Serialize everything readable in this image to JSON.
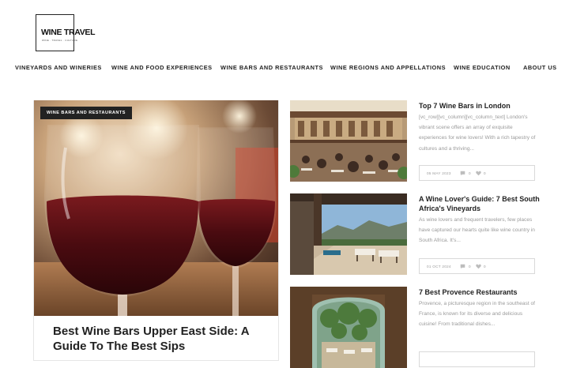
{
  "logo": {
    "title": "WINE TRAVEL",
    "tagline": "WINE · TRAVEL · CULTURE"
  },
  "nav": [
    {
      "label": "VINEYARDS AND WINERIES"
    },
    {
      "label": "WINE AND FOOD EXPERIENCES"
    },
    {
      "label": "WINE BARS AND RESTAURANTS"
    },
    {
      "label": "WINE REGIONS AND APPELLATIONS"
    },
    {
      "label": "WINE EDUCATION"
    },
    {
      "label": "ABOUT US"
    }
  ],
  "featured": {
    "category": "WINE BARS AND RESTAURANTS",
    "title": "Best Wine Bars Upper East Side: A Guide To The Best Sips",
    "image": "red-wine-glasses-photo"
  },
  "posts": [
    {
      "title": "Top 7 Wine Bars in London",
      "excerpt": "[vc_row][vc_column][vc_column_text] London's vibrant scene offers an array of exquisite experiences for wine lovers! With a rich tapestry of cultures and a thriving...",
      "date": "05 MAY 2023",
      "comments": "0",
      "likes": "0",
      "image": "courtyard-bar-photo"
    },
    {
      "title": "A Wine Lover's Guide: 7 Best South Africa's Vineyards",
      "excerpt": "As wine lovers and frequent travelers, few places have captured our hearts quite like wine country in South Africa. It's...",
      "date": "01 OCT 2024",
      "comments": "0",
      "likes": "0",
      "image": "vineyard-terrace-photo"
    },
    {
      "title": "7 Best Provence Restaurants",
      "excerpt": "Provence, a picturesque region in the southeast of France, is known for its diverse and delicious cuisine! From traditional dishes...",
      "date": "",
      "comments": "",
      "likes": "",
      "image": "provence-doorway-photo"
    }
  ],
  "icons": {
    "comments": "comment-icon",
    "likes": "heart-icon"
  },
  "colors": {
    "text": "#222222",
    "muted": "#9a9a9a",
    "badge_bg": "#222222",
    "border": "#d9d9d9"
  }
}
